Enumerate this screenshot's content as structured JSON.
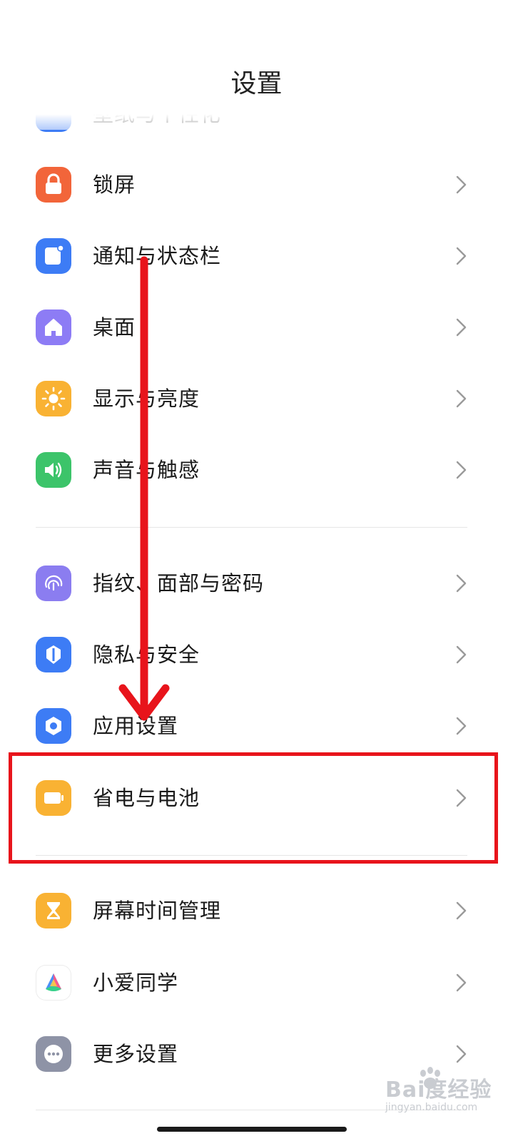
{
  "header": {
    "title": "设置"
  },
  "partial_row": {
    "label": "壁纸与个性化"
  },
  "groups": [
    {
      "items": [
        {
          "label": "锁屏",
          "icon": "lock-icon",
          "color": "#f2653a"
        },
        {
          "label": "通知与状态栏",
          "icon": "notification-icon",
          "color": "#3d7cf5"
        },
        {
          "label": "桌面",
          "icon": "home-icon",
          "color": "#8d7cf5"
        },
        {
          "label": "显示与亮度",
          "icon": "sun-icon",
          "color": "#f9b233"
        },
        {
          "label": "声音与触感",
          "icon": "speaker-icon",
          "color": "#3cc46a"
        }
      ]
    },
    {
      "items": [
        {
          "label": "指纹、面部与密码",
          "icon": "fingerprint-icon",
          "color": "#8b7df0"
        },
        {
          "label": "隐私与安全",
          "icon": "shield-icon",
          "color": "#3d7cf5"
        },
        {
          "label": "应用设置",
          "icon": "app-settings-icon",
          "color": "#3d7cf5"
        },
        {
          "label": "省电与电池",
          "icon": "battery-icon",
          "color": "#f9b233"
        }
      ]
    },
    {
      "items": [
        {
          "label": "屏幕时间管理",
          "icon": "hourglass-icon",
          "color": "#f9b233"
        },
        {
          "label": "小爱同学",
          "icon": "xiaoai-icon",
          "color": "#ffffff"
        },
        {
          "label": "更多设置",
          "icon": "more-icon",
          "color": "#8e93a6"
        }
      ]
    }
  ],
  "annotation": {
    "color": "#e8141b",
    "highlighted_item": "省电与电池"
  },
  "watermark": {
    "brand": "Bai度经验",
    "url": "jingyan.baidu.com"
  }
}
